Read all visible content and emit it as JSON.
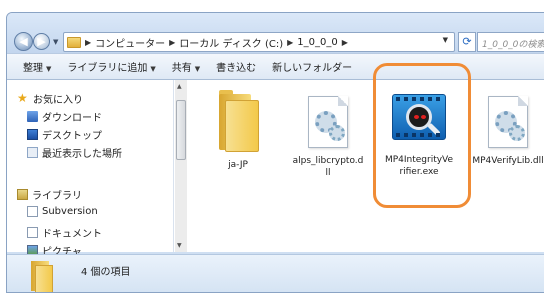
{
  "address": {
    "crumbs": [
      "コンピューター",
      "ローカル ディスク (C:)",
      "1_0_0_0"
    ],
    "search_placeholder": "1_0_0_0の検索"
  },
  "toolbar": {
    "items": [
      "整理",
      "ライブラリに追加",
      "共有",
      "書き込む",
      "新しいフォルダー"
    ]
  },
  "nav": {
    "favorites": "お気に入り",
    "favorites_items": [
      "ダウンロード",
      "デスクトップ",
      "最近表示した場所"
    ],
    "libraries": "ライブラリ",
    "libraries_items": [
      "Subversion",
      "ドキュメント",
      "ピクチャ"
    ]
  },
  "files": [
    {
      "name": "ja-JP",
      "type": "folder"
    },
    {
      "name": "alps_libcrypto.dll",
      "label_line1": "alps_libcrypto.d",
      "label_line2": "ll",
      "type": "dll"
    },
    {
      "name": "MP4IntegrityVerifier.exe",
      "label_line1": "MP4IntegrityVe",
      "label_line2": "rifier.exe",
      "type": "exe"
    },
    {
      "name": "MP4VerifyLib.dll",
      "type": "dll"
    }
  ],
  "status": {
    "item_count": "4 個の項目"
  },
  "colors": {
    "highlight": "#f08c36"
  }
}
